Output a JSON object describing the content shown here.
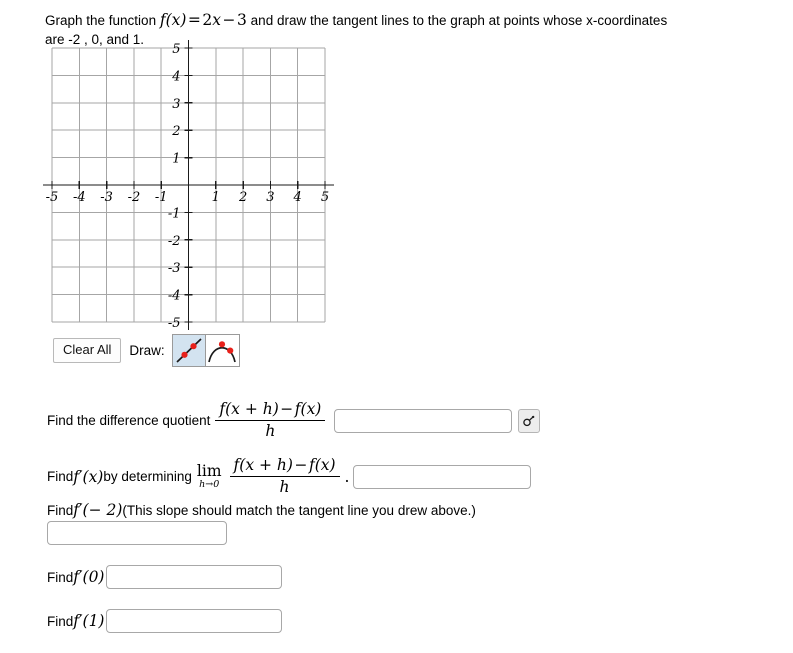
{
  "prompt": {
    "lead": "Graph the function ",
    "func_f": "f",
    "func_args": "(x)",
    "equals": "=",
    "func_rhs_a": "2",
    "func_rhs_x": "x",
    "minus": "−",
    "func_rhs_b": "3",
    "tail": " and draw the tangent lines to the graph at points whose x-coordinates",
    "line2": "are -2 , 0, and 1."
  },
  "graph": {
    "x_min": -5,
    "x_max": 5,
    "y_min": -5,
    "y_max": 5,
    "x_ticks": [
      "-5",
      "-4",
      "-3",
      "-2",
      "-1",
      "1",
      "2",
      "3",
      "4",
      "5"
    ],
    "y_ticks": [
      "5",
      "4",
      "3",
      "2",
      "1",
      "-1",
      "-2",
      "-3",
      "-4",
      "-5"
    ],
    "grid_color": "#a6a6a6",
    "axis_color": "#1a1a1a",
    "tick_label_color": "#000000",
    "plotted_curves": []
  },
  "toolbar": {
    "clear_label": "Clear All",
    "draw_label": "Draw:",
    "tools": [
      {
        "name": "line-tool",
        "selected": true,
        "point_color": "#e8201a",
        "stroke_color": "#1a1a1a"
      },
      {
        "name": "parabola-tool",
        "selected": false,
        "point_color": "#e8201a",
        "stroke_color": "#1a1a1a"
      }
    ],
    "selected_bg": "#d3e3f0"
  },
  "questions": {
    "q1": {
      "label": "Find the difference quotient",
      "num_fx_h": "f(x + h)",
      "num_minus": "−",
      "num_fx": "f(x)",
      "den": "h",
      "value": "",
      "placeholder": "",
      "helper_icon": "math-key-icon"
    },
    "q2": {
      "label_a": "Find ",
      "label_fp": "f′(x)",
      "label_b": " by determining",
      "lim": "lim",
      "lim_sub": "h→0",
      "num_fx_h": "f(x + h)",
      "num_minus": "−",
      "num_fx": "f(x)",
      "den": "h",
      "period": ".",
      "value": "",
      "placeholder": ""
    },
    "q3": {
      "label_a": "Find ",
      "label_fp": "f′(− 2)",
      "label_b": " (This slope should match the tangent line you drew above.)",
      "value": "",
      "placeholder": ""
    },
    "q4": {
      "label_a": "Find ",
      "label_fp": "f′(0)",
      "value": "",
      "placeholder": ""
    },
    "q5": {
      "label_a": "Find ",
      "label_fp": "f′(1)",
      "value": "",
      "placeholder": ""
    }
  }
}
